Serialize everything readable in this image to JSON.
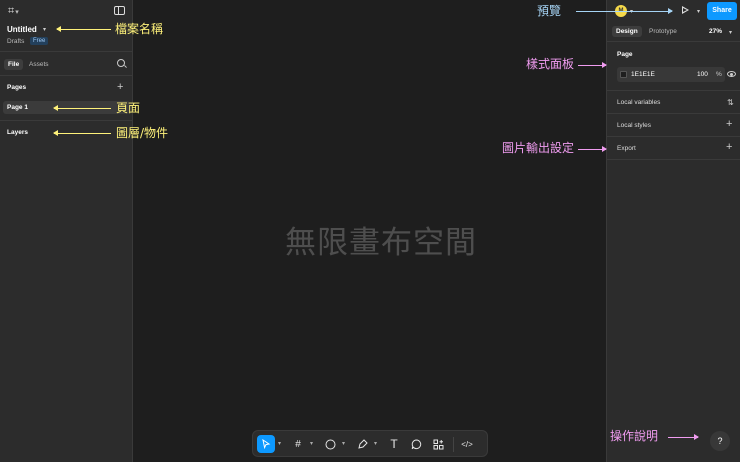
{
  "left_panel": {
    "file_title": "Untitled",
    "location": "Drafts",
    "plan_badge": "Free",
    "tabs": [
      "File",
      "Assets"
    ],
    "pages_header": "Pages",
    "pages": [
      "Page 1"
    ],
    "layers_header": "Layers"
  },
  "canvas": {
    "label": "無限畫布空間"
  },
  "toolbar": {
    "tools": [
      "move-tool",
      "frame-tool",
      "shape-tool",
      "pen-tool",
      "text-tool",
      "comment-tool",
      "actions-tool",
      "dev-mode-toggle"
    ]
  },
  "right_panel": {
    "avatar_initial": "M",
    "share_label": "Share",
    "tabs": [
      "Design",
      "Prototype"
    ],
    "zoom": "27%",
    "page_section": "Page",
    "fill_hex": "1E1E1E",
    "fill_opacity": "100",
    "opacity_unit": "%",
    "local_variables": "Local variables",
    "local_styles": "Local styles",
    "export": "Export",
    "help": "?"
  },
  "annotations": {
    "file_name": "檔案名稱",
    "page": "頁面",
    "layers": "圖層/物件",
    "preview": "預覽",
    "style_panel": "樣式面板",
    "export_settings": "圖片輸出設定",
    "help": "操作說明"
  },
  "colors": {
    "canvas": "#1e1e1e",
    "panel": "#2c2c2c",
    "accent": "#0d99ff",
    "annotation_yellow": "#fff27a",
    "annotation_pink": "#f09cf0",
    "annotation_blue": "#a6d4f5"
  }
}
